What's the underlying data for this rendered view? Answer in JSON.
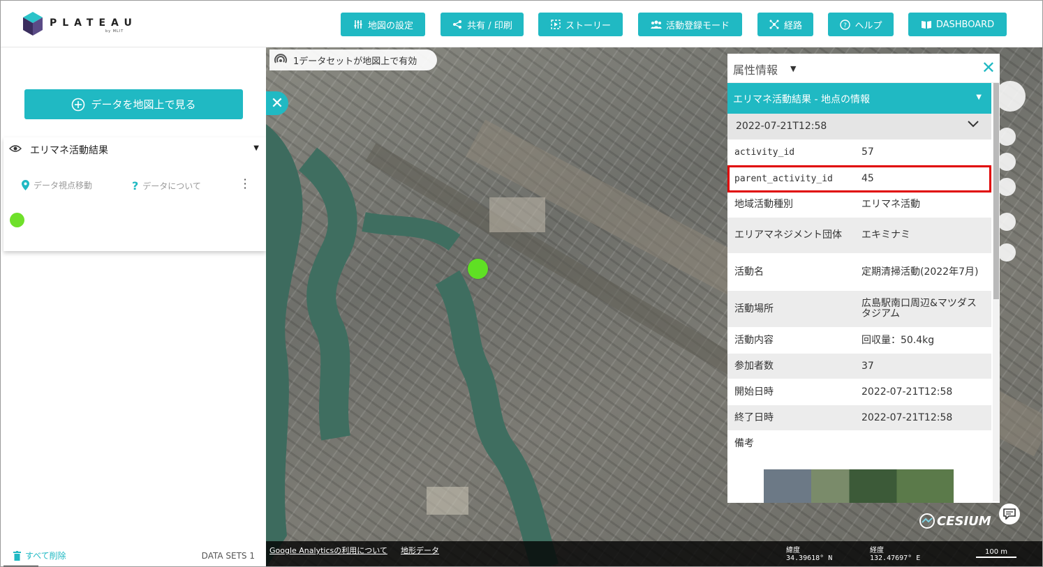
{
  "header": {
    "logo_text": "PLATEAU",
    "logo_sub": "by MLIT",
    "buttons": [
      {
        "label": "地図の設定",
        "icon": "sliders-icon"
      },
      {
        "label": "共有 / 印刷",
        "icon": "share-icon"
      },
      {
        "label": "ストーリー",
        "icon": "story-icon"
      },
      {
        "label": "活動登録モード",
        "icon": "people-icon"
      },
      {
        "label": "経路",
        "icon": "route-icon"
      },
      {
        "label": "ヘルプ",
        "icon": "help-icon"
      },
      {
        "label": "DASHBOARD",
        "icon": "book-icon"
      }
    ]
  },
  "sidebar": {
    "add_data_label": "データを地図上で見る",
    "dataset": {
      "title": "エリマネ活動結果",
      "zoom_label": "データ視点移動",
      "about_label": "データについて",
      "legend_color": "#6fe02a"
    },
    "delete_all_label": "すべて削除",
    "datasets_count_label": "DATA SETS 1"
  },
  "map": {
    "datasets_banner": "1データセットが地図上で有効",
    "marker_color": "#5fe024",
    "attribution_links": [
      "Google Analyticsの利用について",
      "地形データ"
    ],
    "lat_label": "緯度",
    "lat_value": "34.39618° N",
    "lon_label": "経度",
    "lon_value": "132.47697° E",
    "scale_label": "100 m",
    "cesium_label": "CESIUM"
  },
  "attribute_panel": {
    "title": "属性情報",
    "feature_title": "エリマネ活動結果 - 地点の情報",
    "record_title": "2022-07-21T12:58",
    "rows": [
      {
        "key": "activity_id",
        "value": "57"
      },
      {
        "key": "parent_activity_id",
        "value": "45"
      },
      {
        "key": "地域活動種別",
        "value": "エリマネ活動"
      },
      {
        "key": "エリアマネジメント団体",
        "value": "エキミナミ"
      },
      {
        "key": "活動名",
        "value": "定期清掃活動(2022年7月)"
      },
      {
        "key": "活動場所",
        "value": "広島駅南口周辺&マツダスタジアム"
      },
      {
        "key": "活動内容",
        "value": "回収量：50.4kg"
      },
      {
        "key": "参加者数",
        "value": "37"
      },
      {
        "key": "開始日時",
        "value": "2022-07-21T12:58"
      },
      {
        "key": "終了日時",
        "value": "2022-07-21T12:58"
      },
      {
        "key": "備考",
        "value": ""
      }
    ]
  },
  "colors": {
    "accent": "#20b9c3",
    "highlight": "#e00000"
  }
}
